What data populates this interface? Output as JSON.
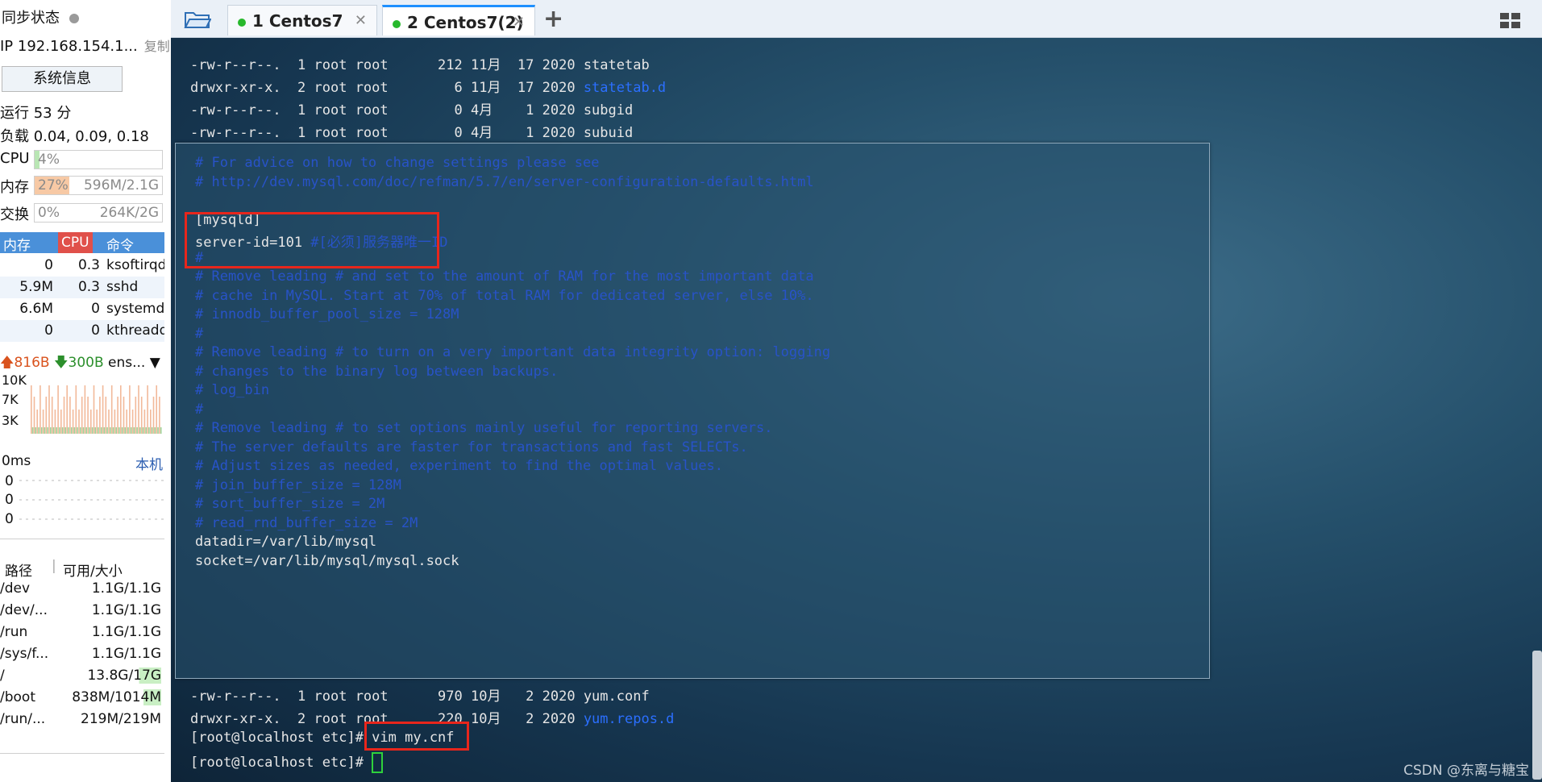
{
  "sidebar": {
    "sync_label": "同步状态",
    "ip_label": "IP 192.168.154.1...",
    "copy_label": "复制",
    "sysinfo_button": "系统信息",
    "uptime": "运行 53 分",
    "load": "负载 0.04, 0.09, 0.18",
    "cpu": {
      "label": "CPU",
      "percent_text": "4%",
      "percent": 4
    },
    "mem": {
      "label": "内存",
      "percent_text": "27%",
      "percent": 27,
      "detail": "596M/2.1G"
    },
    "swap": {
      "label": "交换",
      "percent_text": "0%",
      "percent": 0,
      "detail": "264K/2G"
    },
    "proc_headers": {
      "mem": "内存",
      "cpu": "CPU",
      "cmd": "命令"
    },
    "processes": [
      {
        "mem": "0",
        "cpu": "0.3",
        "cmd": "ksoftirqd"
      },
      {
        "mem": "5.9M",
        "cpu": "0.3",
        "cmd": "sshd"
      },
      {
        "mem": "6.6M",
        "cpu": "0",
        "cmd": "systemd"
      },
      {
        "mem": "0",
        "cpu": "0",
        "cmd": "kthreadd"
      }
    ],
    "net": {
      "up": "816B",
      "down": "300B",
      "iface": "ens..."
    },
    "net_scale": [
      "10K",
      "7K",
      "3K"
    ],
    "latency": {
      "value": "0ms",
      "host": "本机",
      "rows": [
        "0",
        "0",
        "0"
      ]
    },
    "disk_headers": {
      "path": "路径",
      "avail": "可用/大小"
    },
    "disks": [
      {
        "path": "/dev",
        "avail": "1.1G/1.1G"
      },
      {
        "path": "/dev/...",
        "avail": "1.1G/1.1G"
      },
      {
        "path": "/run",
        "avail": "1.1G/1.1G"
      },
      {
        "path": "/sys/f...",
        "avail": "1.1G/1.1G"
      },
      {
        "path": "/",
        "avail": "13.8G/17G"
      },
      {
        "path": "/boot",
        "avail": "838M/1014M"
      },
      {
        "path": "/run/...",
        "avail": "219M/219M"
      }
    ]
  },
  "tabs": [
    {
      "label": "1 Centos7",
      "active": false
    },
    {
      "label": "2 Centos7(2)",
      "active": true
    }
  ],
  "terminal": {
    "top_lines": [
      {
        "text": "-rw-r--r--.  1 root root      212 11月  17 2020 ",
        "name": "statetab",
        "is_dir": false
      },
      {
        "text": "drwxr-xr-x.  2 root root        6 11月  17 2020 ",
        "name": "statetab.d",
        "is_dir": true
      },
      {
        "text": "-rw-r--r--.  1 root root        0 4月    1 2020 ",
        "name": "subgid",
        "is_dir": false
      },
      {
        "text": "-rw-r--r--.  1 root root        0 4月    1 2020 ",
        "name": "subuid",
        "is_dir": false
      }
    ],
    "popup_lines": [
      {
        "text": "# For advice on how to change settings please see",
        "type": "comment"
      },
      {
        "text": "# http://dev.mysql.com/doc/refman/5.7/en/server-configuration-defaults.html",
        "type": "comment"
      },
      {
        "text": "",
        "type": "blank"
      },
      {
        "text": "[mysqld]",
        "type": "normal"
      },
      {
        "text": "server-id=101 ",
        "type": "normal",
        "comment": "#[必须]服务器唯一ID"
      },
      {
        "text": "#",
        "type": "comment"
      },
      {
        "text": "# Remove leading # and set to the amount of RAM for the most important data",
        "type": "comment"
      },
      {
        "text": "# cache in MySQL. Start at 70% of total RAM for dedicated server, else 10%.",
        "type": "comment"
      },
      {
        "text": "# innodb_buffer_pool_size = 128M",
        "type": "comment"
      },
      {
        "text": "#",
        "type": "comment"
      },
      {
        "text": "# Remove leading # to turn on a very important data integrity option: logging",
        "type": "comment"
      },
      {
        "text": "# changes to the binary log between backups.",
        "type": "comment"
      },
      {
        "text": "# log_bin",
        "type": "comment"
      },
      {
        "text": "#",
        "type": "comment"
      },
      {
        "text": "# Remove leading # to set options mainly useful for reporting servers.",
        "type": "comment"
      },
      {
        "text": "# The server defaults are faster for transactions and fast SELECTs.",
        "type": "comment"
      },
      {
        "text": "# Adjust sizes as needed, experiment to find the optimal values.",
        "type": "comment"
      },
      {
        "text": "# join_buffer_size = 128M",
        "type": "comment"
      },
      {
        "text": "# sort_buffer_size = 2M",
        "type": "comment"
      },
      {
        "text": "# read_rnd_buffer_size = 2M",
        "type": "comment"
      },
      {
        "text": "datadir=/var/lib/mysql",
        "type": "normal"
      },
      {
        "text": "socket=/var/lib/mysql/mysql.sock",
        "type": "normal"
      }
    ],
    "bottom_lines": [
      {
        "text": "-rw-r--r--.  1 root root      970 10月   2 2020 ",
        "name": "yum.conf",
        "is_dir": false
      },
      {
        "text": "drwxr-xr-x.  2 root root      220 10月   2 2020 ",
        "name": "yum.repos.d",
        "is_dir": true
      }
    ],
    "prompt": "[root@localhost etc]# ",
    "command": "vim my.cnf",
    "prompt2": "[root@localhost etc]# "
  },
  "watermark": "CSDN @东离与糖宝",
  "colors": {
    "accent": "#1e90ff",
    "highlight_box": "#e8261c",
    "comment": "#2853c8",
    "dir": "#2b6fff",
    "cursor": "#2fd13c"
  }
}
